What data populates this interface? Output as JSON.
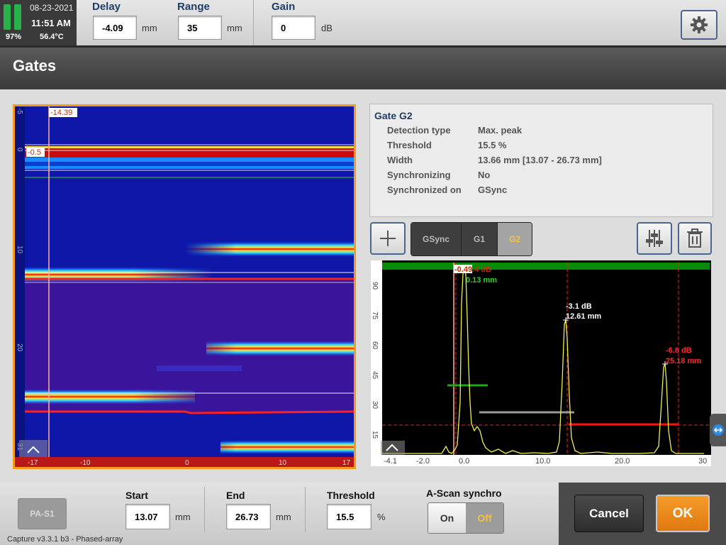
{
  "status": {
    "date": "08-23-2021",
    "time": "11:51 AM",
    "battery": "97%",
    "temperature": "56.4°C"
  },
  "header": {
    "delay": {
      "label": "Delay",
      "value": "-4.09",
      "unit": "mm"
    },
    "range": {
      "label": "Range",
      "value": "35",
      "unit": "mm"
    },
    "gain": {
      "label": "Gain",
      "value": "0",
      "unit": "dB"
    },
    "settings_icon": "gear-icon"
  },
  "title": "Gates",
  "bscan": {
    "cursor_label": "-14.39",
    "depth_cursor_label": "-0.5",
    "y_ticks": [
      "-5",
      "0",
      "10",
      "20",
      "31"
    ],
    "x_ticks": [
      "-17",
      "-10",
      "0",
      "10",
      "17"
    ]
  },
  "gate_info": {
    "title": "Gate G2",
    "rows": [
      {
        "label": "Detection type",
        "value": "Max. peak"
      },
      {
        "label": "Threshold",
        "value": "15.5 %"
      },
      {
        "label": "Width",
        "value": "13.66 mm [13.07 - 26.73 mm]"
      },
      {
        "label": "Synchronizing",
        "value": "No"
      },
      {
        "label": "Synchronized on",
        "value": "GSync"
      }
    ]
  },
  "gate_tabs": [
    {
      "label": "GSync",
      "selected": false
    },
    {
      "label": "G1",
      "selected": false
    },
    {
      "label": "G2",
      "selected": true
    }
  ],
  "ascan": {
    "y_ticks": [
      "90",
      "75",
      "60",
      "45",
      "30",
      "15"
    ],
    "x_ticks": [
      "-4.1",
      "-2.0",
      "0.0",
      "10.0",
      "20.0",
      "30"
    ],
    "peak_labels": [
      {
        "db": "-0.49.4 dB",
        "mm": "0.13 mm",
        "color": "#2bd12b"
      },
      {
        "db": "-3.1 dB",
        "mm": "12.61 mm",
        "color": "#ffffff"
      },
      {
        "db": "-6.6 dB",
        "mm": "25.18 mm",
        "color": "#ff2a2a"
      }
    ]
  },
  "footer": {
    "probe": "PA-S1",
    "version": "Capture v3.3.1 b3 - Phased-array",
    "start": {
      "label": "Start",
      "value": "13.07",
      "unit": "mm"
    },
    "end": {
      "label": "End",
      "value": "26.73",
      "unit": "mm"
    },
    "threshold": {
      "label": "Threshold",
      "value": "15.5",
      "unit": "%"
    },
    "synchro": {
      "label": "A-Scan synchro",
      "on": "On",
      "off": "Off",
      "selected": "Off"
    },
    "cancel": "Cancel",
    "ok": "OK"
  },
  "colors": {
    "accent": "#f39b18",
    "gate_red": "#ff2020",
    "trace": "#f0f050"
  }
}
